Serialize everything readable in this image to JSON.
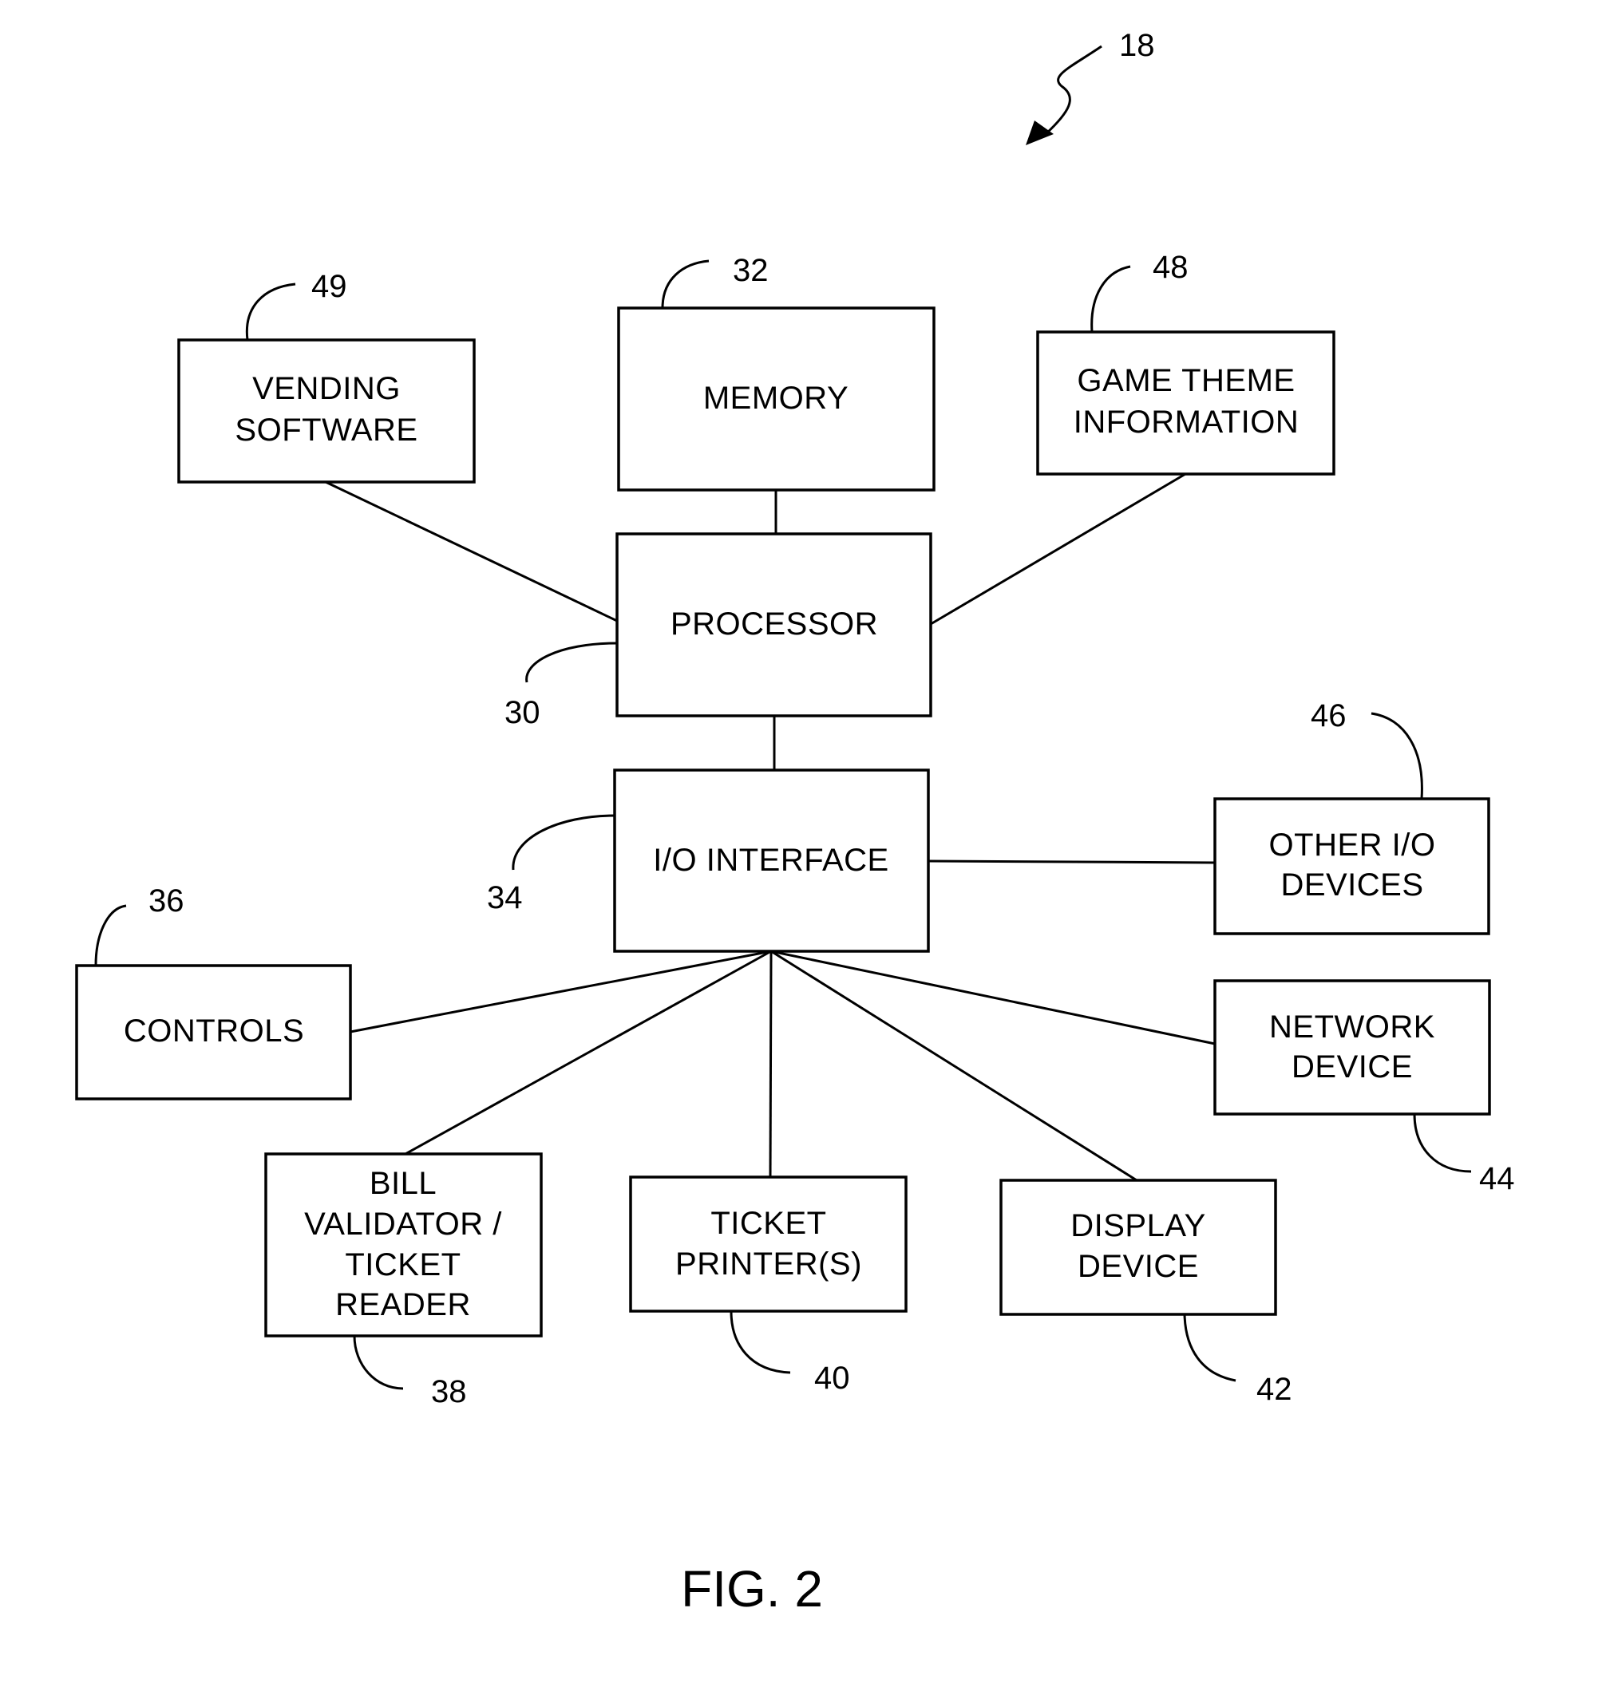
{
  "figure": {
    "caption": "FIG. 2",
    "reference_numeral": "18"
  },
  "blocks": {
    "vending_software": {
      "lines": [
        "VENDING",
        "SOFTWARE"
      ],
      "ref": "49"
    },
    "memory": {
      "lines": [
        "MEMORY"
      ],
      "ref": "32"
    },
    "game_theme": {
      "lines": [
        "GAME THEME",
        "INFORMATION"
      ],
      "ref": "48"
    },
    "processor": {
      "lines": [
        "PROCESSOR"
      ],
      "ref": "30"
    },
    "io_interface": {
      "lines": [
        "I/O INTERFACE"
      ],
      "ref": "34"
    },
    "other_io": {
      "lines": [
        "OTHER I/O",
        "DEVICES"
      ],
      "ref": "46"
    },
    "controls": {
      "lines": [
        "CONTROLS"
      ],
      "ref": "36"
    },
    "network_device": {
      "lines": [
        "NETWORK",
        "DEVICE"
      ],
      "ref": "44"
    },
    "bill_validator": {
      "lines": [
        "BILL",
        "VALIDATOR /",
        "TICKET",
        "READER"
      ],
      "ref": "38"
    },
    "ticket_printer": {
      "lines": [
        "TICKET",
        "PRINTER(S)"
      ],
      "ref": "40"
    },
    "display_device": {
      "lines": [
        "DISPLAY",
        "DEVICE"
      ],
      "ref": "42"
    }
  },
  "connections": [
    [
      "vending_software",
      "processor"
    ],
    [
      "memory",
      "processor"
    ],
    [
      "game_theme",
      "processor"
    ],
    [
      "processor",
      "io_interface"
    ],
    [
      "io_interface",
      "other_io"
    ],
    [
      "io_interface",
      "controls"
    ],
    [
      "io_interface",
      "network_device"
    ],
    [
      "io_interface",
      "bill_validator"
    ],
    [
      "io_interface",
      "ticket_printer"
    ],
    [
      "io_interface",
      "display_device"
    ]
  ]
}
